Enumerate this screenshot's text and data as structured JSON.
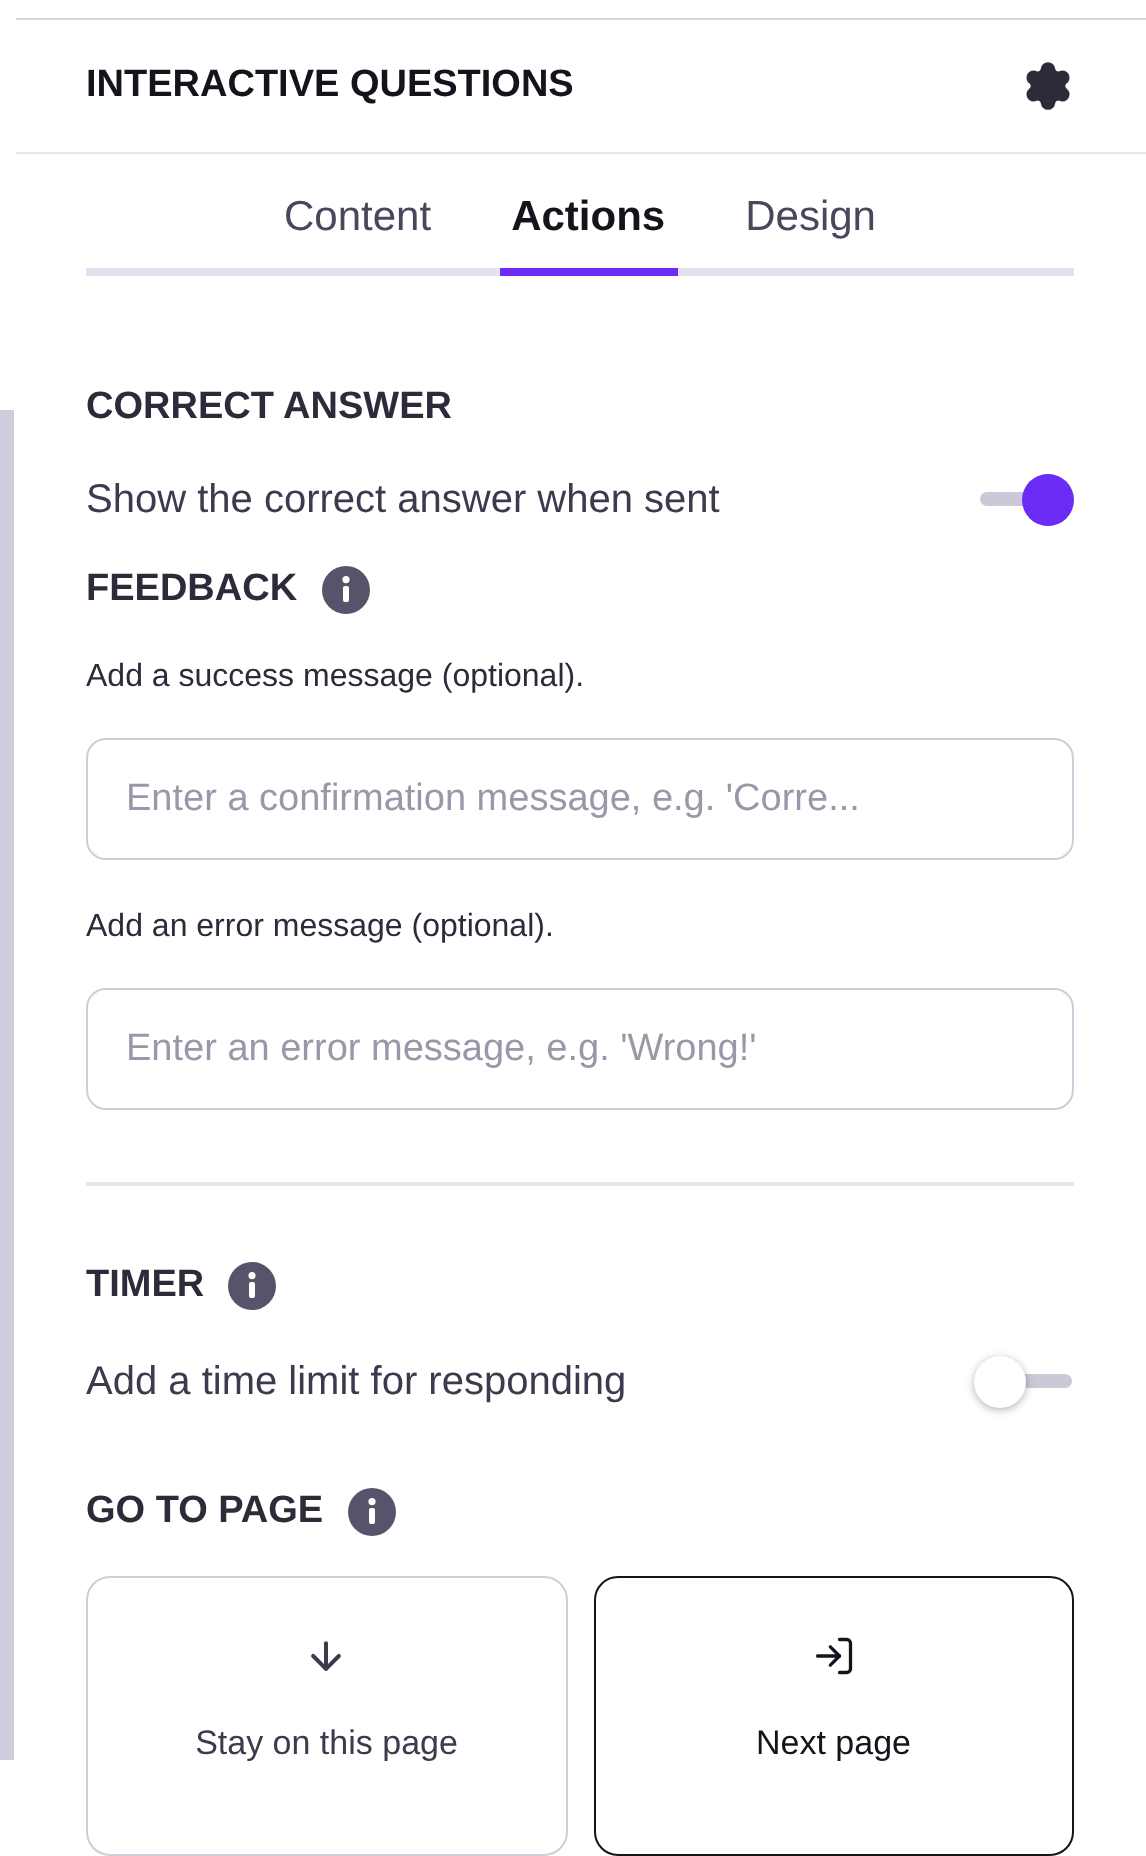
{
  "panel": {
    "title": "INTERACTIVE QUESTIONS"
  },
  "tabs": [
    {
      "label": "Content",
      "selected": false
    },
    {
      "label": "Actions",
      "selected": true
    },
    {
      "label": "Design",
      "selected": false
    }
  ],
  "correct_answer": {
    "heading": "CORRECT ANSWER",
    "label": "Show the correct answer when sent",
    "on": true
  },
  "feedback": {
    "heading": "FEEDBACK",
    "success_label": "Add a success message (optional).",
    "success_placeholder": "Enter a confirmation message, e.g. 'Corre...",
    "error_label": "Add an error message (optional).",
    "error_placeholder": "Enter an error message, e.g. 'Wrong!'"
  },
  "timer": {
    "heading": "TIMER",
    "label": "Add a time limit for responding",
    "on": false
  },
  "go_to_page": {
    "heading": "GO TO PAGE",
    "options": [
      {
        "label": "Stay on this page",
        "kind": "stay",
        "selected": false
      },
      {
        "label": "Next page",
        "kind": "next",
        "selected": true
      }
    ]
  }
}
